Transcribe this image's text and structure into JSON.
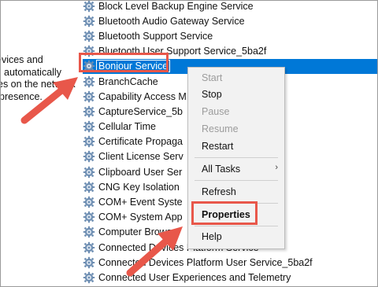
{
  "description_lines": [
    "evices and",
    "automatically",
    "es on the network",
    "presence."
  ],
  "services": [
    "Block Level Backup Engine Service",
    "Bluetooth Audio Gateway Service",
    "Bluetooth Support Service",
    "Bluetooth User Support Service_5ba2f",
    "Bonjour Service",
    "BranchCache",
    "Capability Access M",
    "CaptureService_5b",
    "Cellular Time",
    "Certificate Propaga",
    "Client License Serv",
    "Clipboard User Ser",
    "CNG Key Isolation",
    "COM+ Event Syste",
    "COM+ System App",
    "Computer Brows",
    "Connected Devices Platform Service",
    "Connected Devices Platform User Service_5ba2f",
    "Connected User Experiences and Telemetry"
  ],
  "selected_service_index": 4,
  "context_menu": {
    "start": "Start",
    "stop": "Stop",
    "pause": "Pause",
    "resume": "Resume",
    "restart": "Restart",
    "all_tasks": "All Tasks",
    "refresh": "Refresh",
    "properties": "Properties",
    "help": "Help"
  },
  "icons": {
    "service": "gear-icon",
    "submenu": "chevron-right-icon"
  },
  "colors": {
    "selection": "#0078d7",
    "highlight_red": "#e8574a",
    "menu_bg": "#f2f2f2"
  }
}
